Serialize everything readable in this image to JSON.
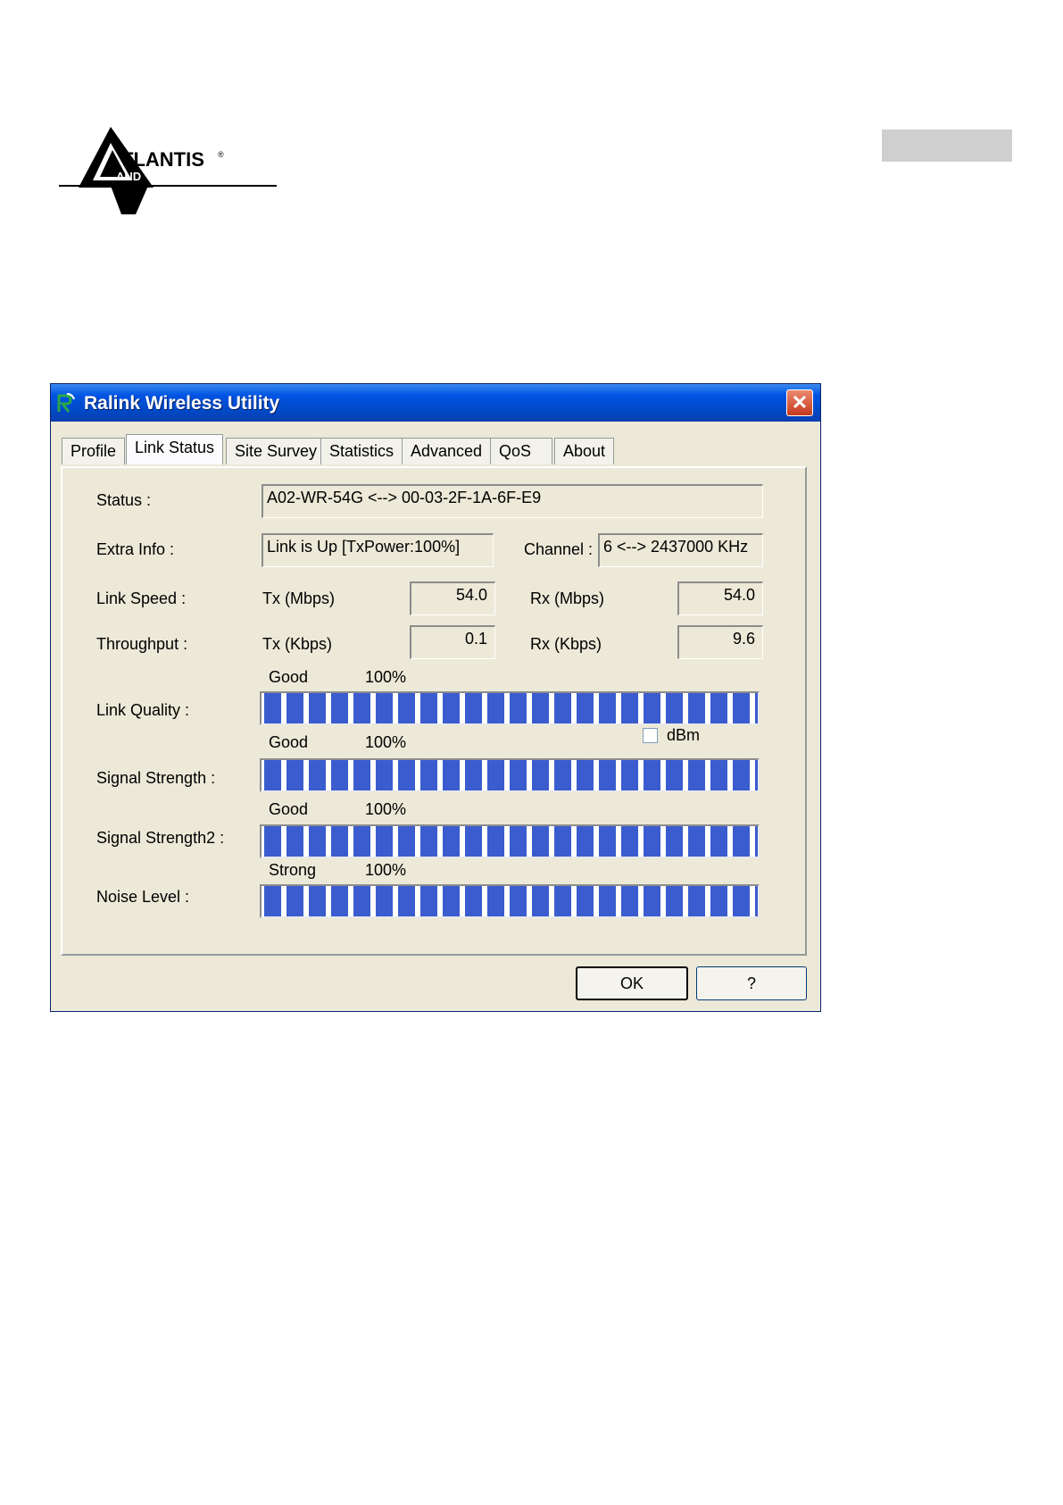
{
  "header": {
    "logo_text": "ATLANTIS AND"
  },
  "window": {
    "title": "Ralink Wireless Utility",
    "close_label": "✕",
    "tabs": [
      {
        "label": "Profile",
        "active": false
      },
      {
        "label": "Link Status",
        "active": true
      },
      {
        "label": "Site Survey",
        "active": false
      },
      {
        "label": "Statistics",
        "active": false
      },
      {
        "label": "Advanced",
        "active": false
      },
      {
        "label": "QoS",
        "active": false
      },
      {
        "label": "About",
        "active": false
      }
    ]
  },
  "link_status": {
    "status_label": "Status :",
    "status_value": "A02-WR-54G <--> 00-03-2F-1A-6F-E9",
    "extra_info_label": "Extra Info :",
    "extra_info_value": "Link is Up [TxPower:100%]",
    "channel_label": "Channel :",
    "channel_value": "6 <--> 2437000 KHz",
    "link_speed_label": "Link Speed :",
    "link_speed_tx_label": "Tx (Mbps)",
    "link_speed_tx_value": "54.0",
    "link_speed_rx_label": "Rx (Mbps)",
    "link_speed_rx_value": "54.0",
    "throughput_label": "Throughput :",
    "throughput_tx_label": "Tx (Kbps)",
    "throughput_tx_value": "0.1",
    "throughput_rx_label": "Rx (Kbps)",
    "throughput_rx_value": "9.6",
    "link_quality": {
      "label": "Link Quality :",
      "rating": "Good",
      "percent_text": "100%",
      "level": 1.0
    },
    "signal_strength": {
      "label": "Signal Strength :",
      "rating": "Good",
      "percent_text": "100%",
      "level": 1.0
    },
    "signal_strength2": {
      "label": "Signal Strength2 :",
      "rating": "Good",
      "percent_text": "100%",
      "level": 1.0
    },
    "noise_level": {
      "label": "Noise Level :",
      "rating": "Strong",
      "percent_text": "100%",
      "level": 1.0
    },
    "dbm_label": "dBm",
    "dbm_checked": false
  },
  "buttons": {
    "ok_label": "OK",
    "help_label": "?"
  },
  "colors": {
    "bar_fill": "#3b5ccf",
    "title_bar": "#0054e3",
    "close_button": "#c7381c"
  }
}
